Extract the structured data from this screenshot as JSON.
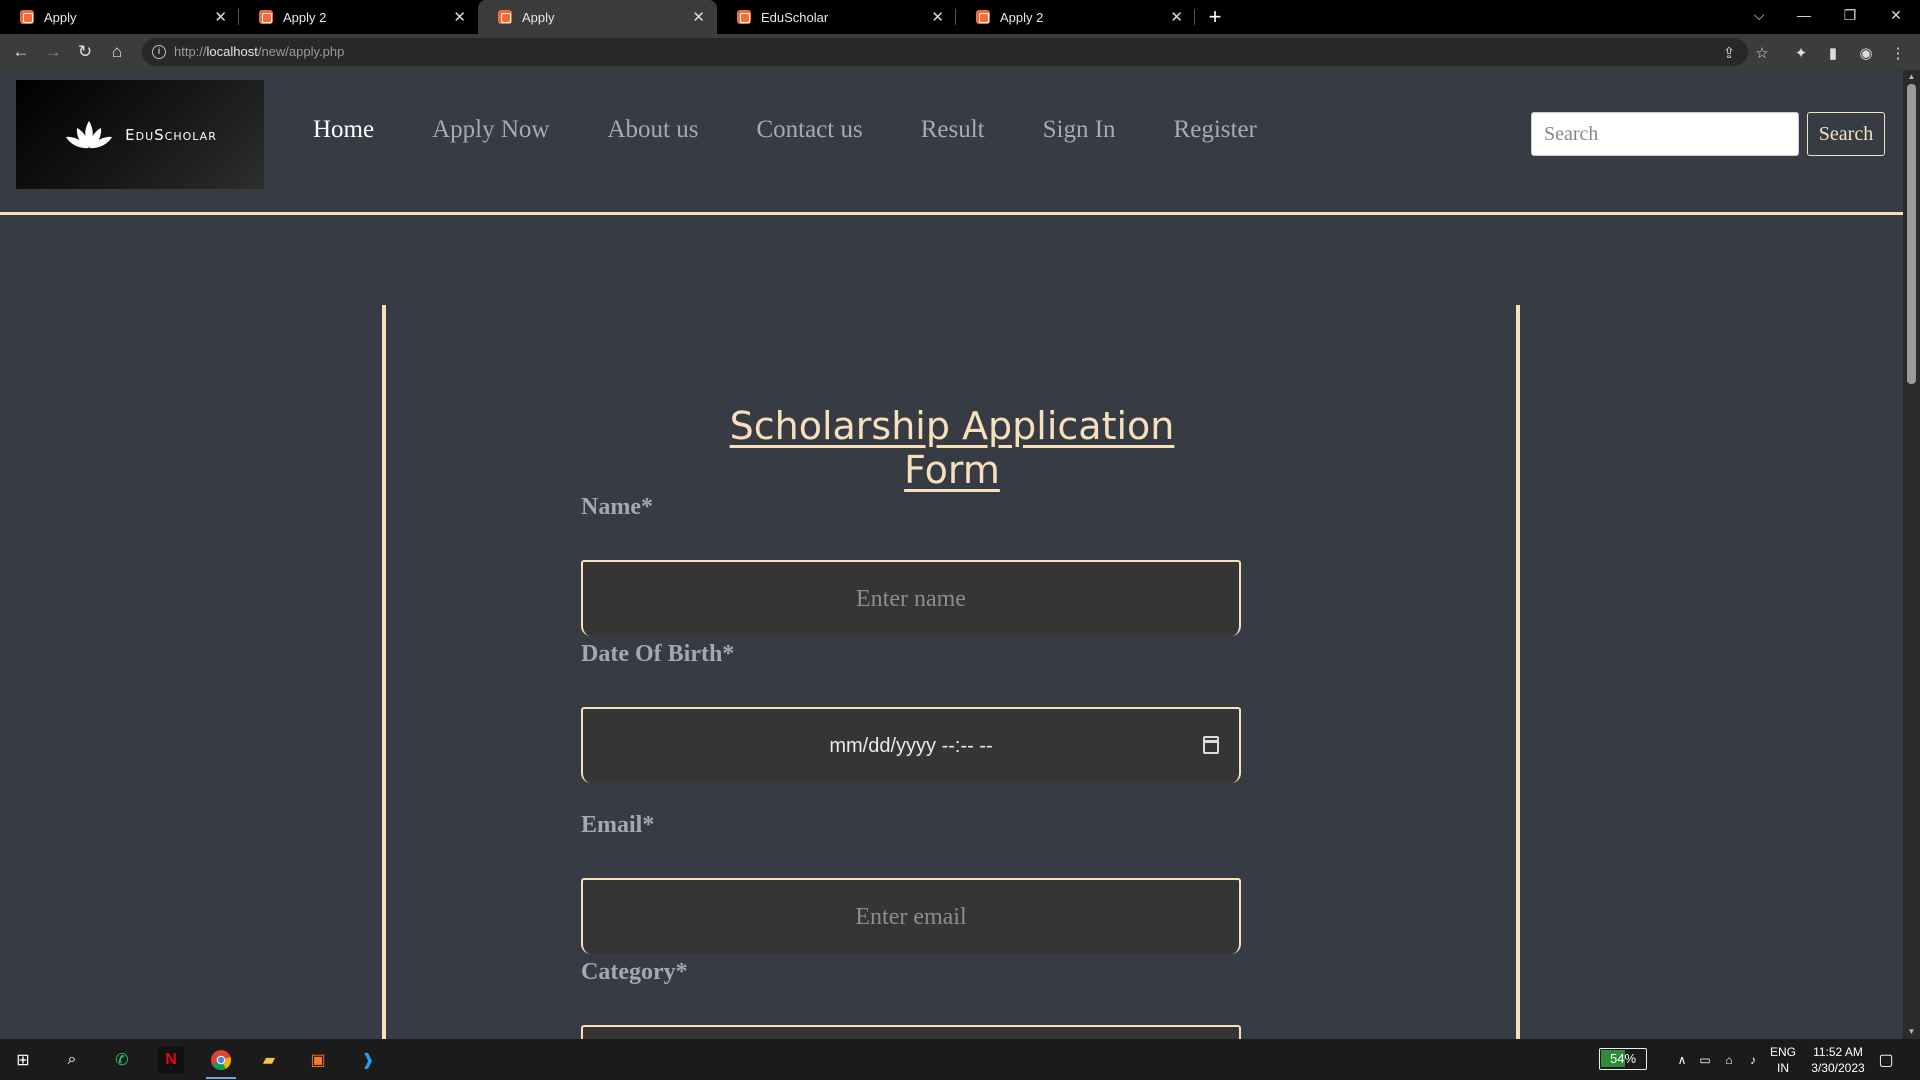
{
  "browser": {
    "tabs": [
      {
        "title": "Apply",
        "active": false
      },
      {
        "title": "Apply 2",
        "active": false
      },
      {
        "title": "Apply",
        "active": true
      },
      {
        "title": "EduScholar",
        "active": false
      },
      {
        "title": "Apply 2",
        "active": false
      }
    ],
    "url_prefix": "http://",
    "url_host": "localhost",
    "url_path": "/new/apply.php"
  },
  "site": {
    "logo_text": "EduScholar",
    "nav": [
      "Home",
      "Apply Now",
      "About us",
      "Contact us",
      "Result",
      "Sign In",
      "Register"
    ],
    "active_nav": "Home",
    "search_placeholder": "Search",
    "search_button": "Search"
  },
  "form": {
    "title": "Scholarship Application Form",
    "name_label": "Name*",
    "name_placeholder": "Enter name",
    "dob_label": "Date Of Birth*",
    "dob_placeholder": "mm/dd/yyyy --:-- --",
    "email_label": "Email*",
    "email_placeholder": "Enter email",
    "category_label": "Category*"
  },
  "taskbar": {
    "battery_percent": 54,
    "battery_label": "54%",
    "lang_line1": "ENG",
    "lang_line2": "IN",
    "time": "11:52 AM",
    "date": "3/30/2023"
  },
  "colors": {
    "page_bg": "#363b44",
    "accent": "#f7e0bc",
    "nav_text": "#a9aab0",
    "field_bg": "#353535"
  }
}
